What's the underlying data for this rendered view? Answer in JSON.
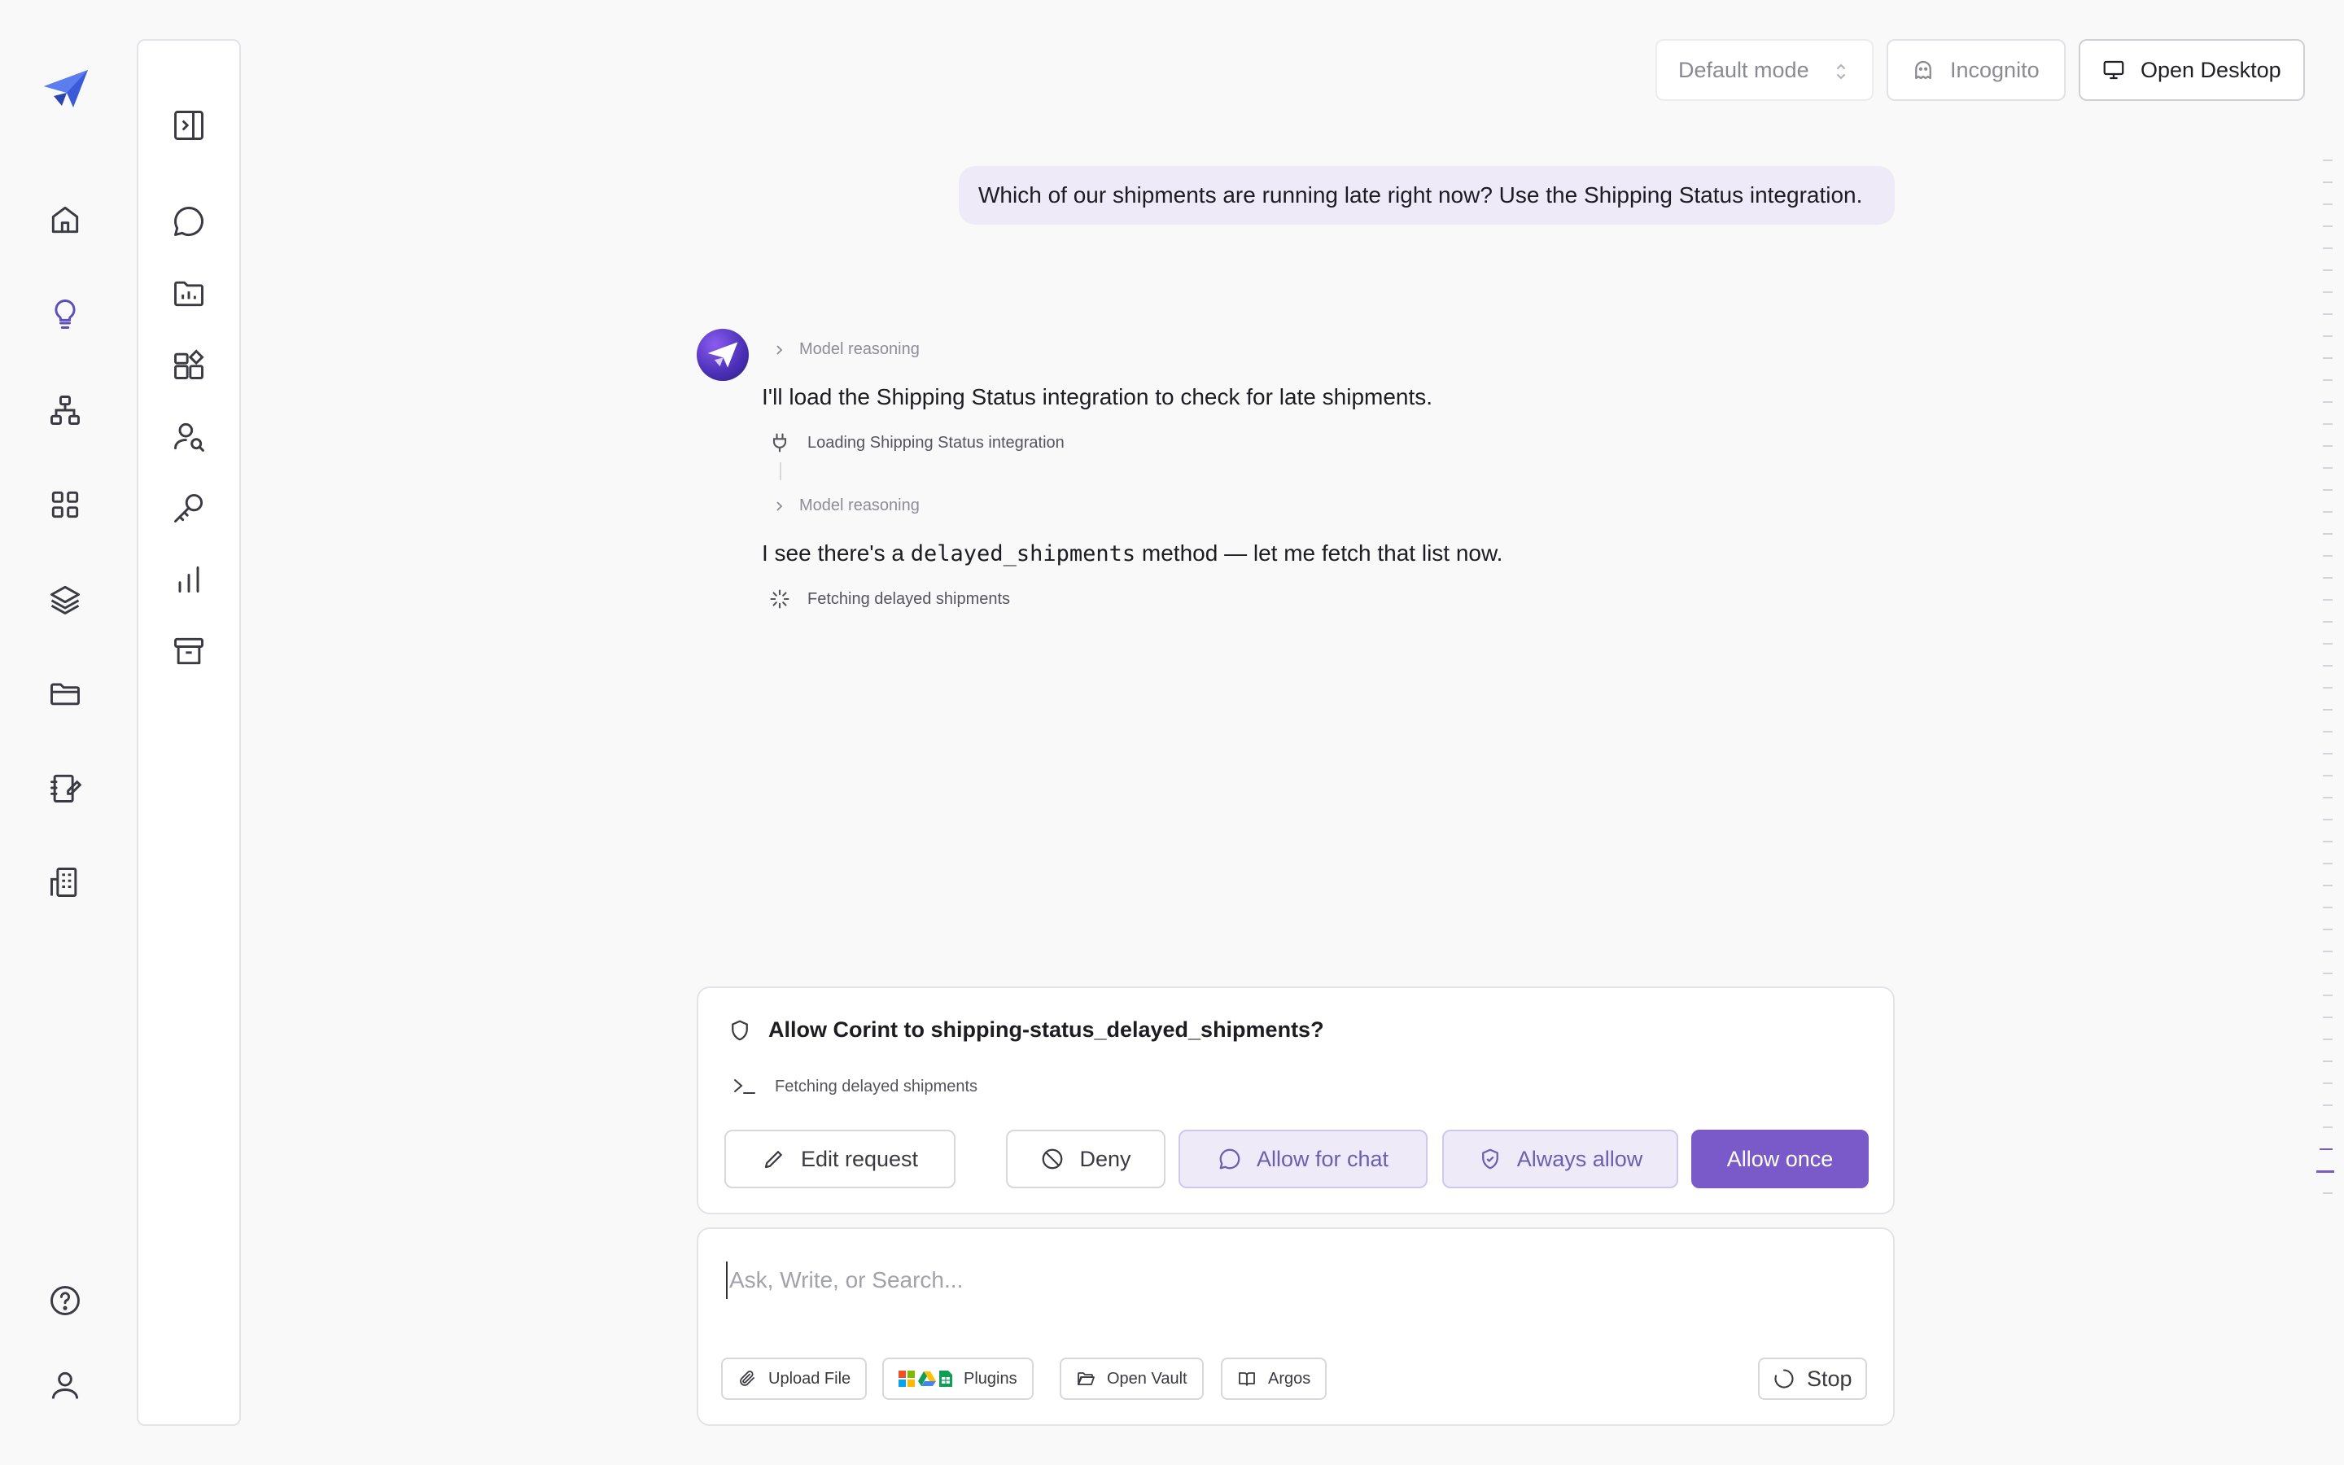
{
  "topbar": {
    "mode_label": "Default mode",
    "incognito_label": "Incognito",
    "open_desktop_label": "Open Desktop"
  },
  "conversation": {
    "user_message": "Which of our shipments are running late right now? Use the Shipping Status integration.",
    "reasoning_label": "Model reasoning",
    "assistant_1": "I'll load the Shipping Status integration to check for late shipments.",
    "tool_1": "Loading Shipping Status integration",
    "assistant_2_before": "I see there's a ",
    "assistant_2_code": "delayed_shipments",
    "assistant_2_after": " method — let me fetch that list now.",
    "tool_2": "Fetching delayed shipments"
  },
  "permission": {
    "title": "Allow Corint to shipping-status_delayed_shipments?",
    "command": "Fetching delayed shipments",
    "edit_label": "Edit request",
    "deny_label": "Deny",
    "allow_chat_label": "Allow for chat",
    "always_allow_label": "Always allow",
    "allow_once_label": "Allow once"
  },
  "composer": {
    "placeholder": "Ask, Write, or Search...",
    "upload_label": "Upload File",
    "plugins_label": "Plugins",
    "vault_label": "Open Vault",
    "argos_label": "Argos",
    "stop_label": "Stop"
  },
  "colors": {
    "accent": "#7a5ac8",
    "accent_soft": "#eeeaf8",
    "background": "#f9f9fa"
  },
  "icons": {
    "rail": [
      "logo",
      "home-icon",
      "lightbulb-icon",
      "sitemap-icon",
      "grid-icon",
      "layers-icon",
      "folder-icon",
      "notebook-edit-icon",
      "building-icon",
      "help-icon",
      "user-icon"
    ],
    "panel": [
      "sidebar-toggle-icon",
      "chat-bubble-icon",
      "folder-chart-icon",
      "widgets-icon",
      "user-search-icon",
      "key-icon",
      "bar-chart-icon",
      "archive-icon"
    ]
  }
}
